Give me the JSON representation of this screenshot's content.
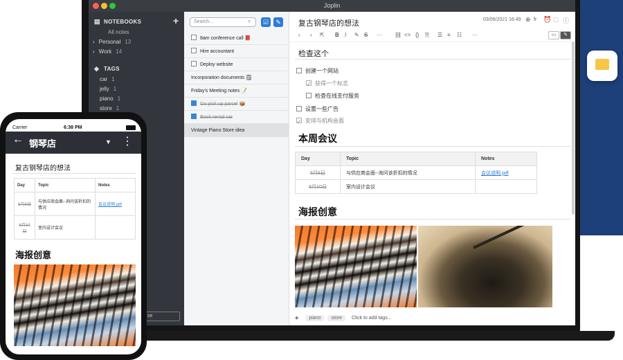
{
  "laptop": {
    "window_title": "Joplin",
    "sidebar": {
      "notebooks_header": "NOTEBOOKS",
      "add_symbol": "+",
      "all_notes": "All notes",
      "notebooks": [
        {
          "arrow": "›",
          "name": "Personal",
          "count": "13"
        },
        {
          "arrow": "›",
          "name": "Work",
          "count": "14"
        }
      ],
      "tags_header": "TAGS",
      "tags": [
        {
          "name": "car",
          "count": "1"
        },
        {
          "name": "jelly",
          "count": "1"
        },
        {
          "name": "piano",
          "count": "1"
        },
        {
          "name": "store",
          "count": "1"
        }
      ],
      "bottom_button_partial": "se"
    },
    "note_list": {
      "search_placeholder": "Search...",
      "notes": [
        {
          "title": "8am conference call",
          "todo": true,
          "done": false,
          "emoji": "📕"
        },
        {
          "title": "Hire accountant",
          "todo": true,
          "done": false,
          "emoji": ""
        },
        {
          "title": "Deploy website",
          "todo": true,
          "done": false,
          "emoji": ""
        },
        {
          "title": "Incorporation documents",
          "todo": false,
          "done": false,
          "emoji": "🗒"
        },
        {
          "title": "Friday's Meeting notes",
          "todo": false,
          "done": false,
          "emoji": "📝"
        },
        {
          "title": "Go pick up parcel",
          "todo": true,
          "done": true,
          "emoji": "📦"
        },
        {
          "title": "Book rental car",
          "todo": true,
          "done": true,
          "emoji": ""
        },
        {
          "title": "Vintage Piano Store idea",
          "todo": false,
          "done": false,
          "emoji": "",
          "selected": true
        }
      ]
    },
    "editor": {
      "note_title": "复古钢琴店的想法",
      "date": "03/06/2021 16:49",
      "language": "fr",
      "h_checklist": "检查这个",
      "todos": [
        {
          "text": "创建一个网站",
          "done": false,
          "indent": 0
        },
        {
          "text": "获得一个标志",
          "done": true,
          "indent": 1
        },
        {
          "text": "检查在线支付服务",
          "done": false,
          "indent": 1
        },
        {
          "text": "设置一些广告",
          "done": false,
          "indent": 0
        },
        {
          "text": "安排与机构会面",
          "done": true,
          "indent": 0
        }
      ],
      "h_meeting": "本周会议",
      "table": {
        "headers": [
          "Day",
          "Topic",
          "Notes"
        ],
        "rows": [
          [
            "6月8日",
            "与供应商会面--询问该折扣的情况",
            "会议说明.pdf"
          ],
          [
            "6月10日",
            "室内设计会议",
            ""
          ]
        ]
      },
      "h_poster": "海报创意",
      "tag_chips": [
        "piano",
        "store"
      ],
      "add_tags": "Click to add tags..."
    }
  },
  "phone": {
    "carrier": "Carrier",
    "time": "6:38 PM",
    "back_arrow": "←",
    "notebook_title": "钢琴店",
    "menu_caret": "▼",
    "menu_dots": "⋮",
    "note_title": "复古钢琴店的想法",
    "table": {
      "headers": [
        "Day",
        "Topic",
        "Notes"
      ],
      "rows": [
        [
          "6月8日",
          "与供应商会面--询问该折扣的情况",
          "会议说明.pdf"
        ],
        [
          "6月10日",
          "室内设计会议",
          ""
        ]
      ]
    },
    "h_poster": "海报创意"
  },
  "colors": {
    "accent": "#2e7bd6",
    "sidebar_bg": "#33373d",
    "backdrop_blue": "#1d3f7a"
  }
}
